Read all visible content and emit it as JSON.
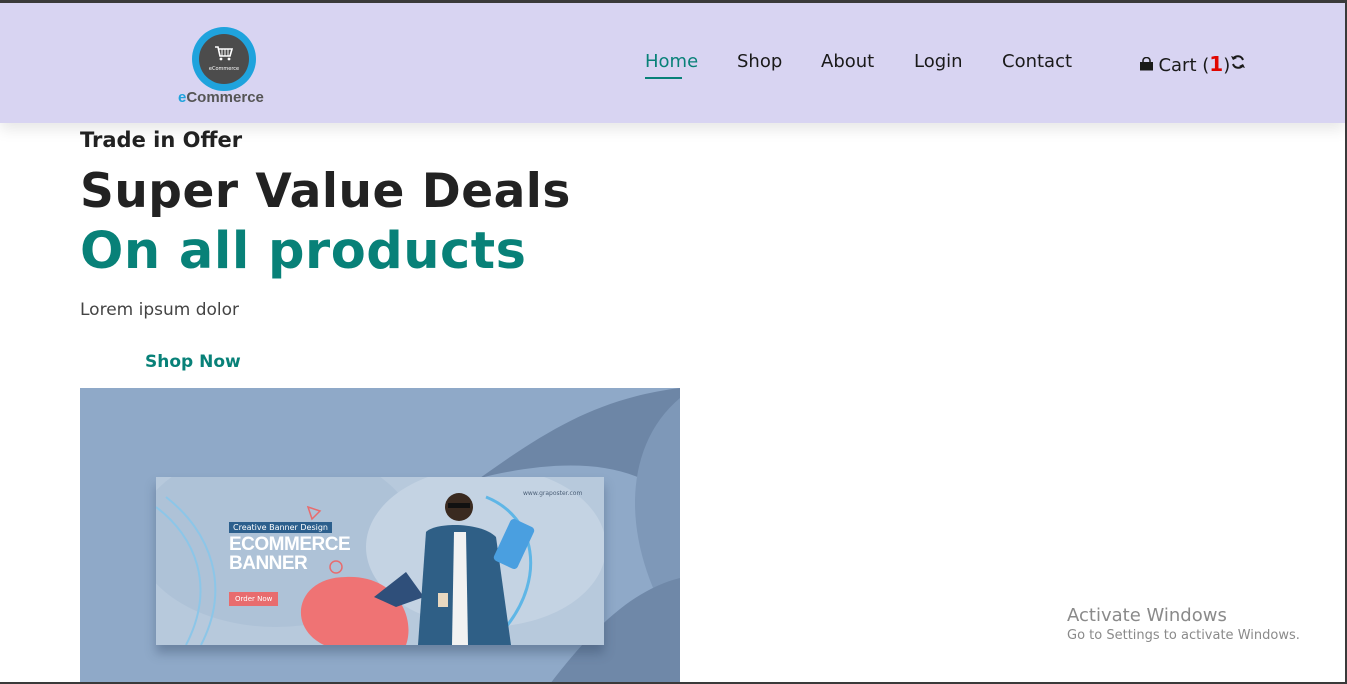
{
  "brand": {
    "name_prefix": "e",
    "name_rest": "Commerce",
    "badge_text": "eCommerce",
    "icon": "shopping-cart-icon"
  },
  "nav": {
    "items": [
      {
        "label": "Home",
        "active": true
      },
      {
        "label": "Shop",
        "active": false
      },
      {
        "label": "About",
        "active": false
      },
      {
        "label": "Login",
        "active": false
      },
      {
        "label": "Contact",
        "active": false
      }
    ]
  },
  "cart": {
    "label": "Cart (",
    "count": "1",
    "close": ")",
    "icon": "shopping-bag-icon",
    "refresh_icon": "refresh-icon"
  },
  "hero": {
    "eyebrow": "Trade in Offer",
    "title": "Super Value Deals",
    "subtitle": "On all products",
    "description": "Lorem ipsum dolor",
    "cta": "Shop Now"
  },
  "banner": {
    "tag": "Creative Banner Design",
    "line1": "ECOMMERCE",
    "line2": "BANNER",
    "order_button": "Order Now",
    "website": "www.graposter.com"
  },
  "watermark": {
    "line1": "Activate Windows",
    "line2": "Go to Settings to activate Windows."
  },
  "colors": {
    "accent": "#088178",
    "navbar_bg": "#d8d4f2",
    "cart_count": "#e10600"
  }
}
